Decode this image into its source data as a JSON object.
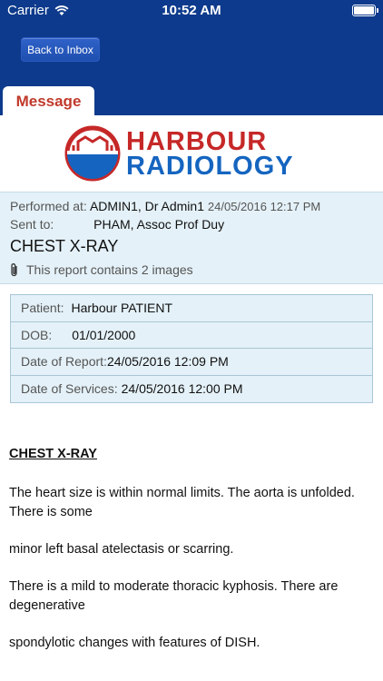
{
  "status_bar": {
    "carrier": "Carrier",
    "time": "10:52 AM"
  },
  "nav": {
    "back_label": "Back to Inbox",
    "tab_label": "Message"
  },
  "logo": {
    "word1": "HARBOUR",
    "word2": "RADIOLOGY"
  },
  "info": {
    "performed_label": "Performed at:",
    "performed_value": "ADMIN1, Dr Admin1",
    "performed_time": "24/05/2016 12:17 PM",
    "sent_label": "Sent to:",
    "sent_value": "PHAM, Assoc Prof Duy",
    "title": "CHEST X-RAY",
    "attachment_text": "This report contains 2 images"
  },
  "patient": {
    "rows": [
      {
        "label": "Patient:",
        "value": "Harbour PATIENT"
      },
      {
        "label": "DOB:",
        "value": "01/01/2000"
      },
      {
        "label": "Date of Report:",
        "value": "24/05/2016 12:09 PM"
      },
      {
        "label": "Date of Services:",
        "value": "24/05/2016 12:00 PM"
      }
    ]
  },
  "report": {
    "heading": "CHEST X-RAY",
    "paragraphs": [
      "The heart size is within normal limits. The aorta is unfolded. There is some",
      "minor left basal atelectasis or scarring.",
      "There is a mild to moderate thoracic kyphosis. There are degenerative",
      "spondylotic changes with features of DISH."
    ]
  },
  "colors": {
    "header_bg": "#0d3a8c",
    "tab_text": "#c0392b",
    "info_bg": "#e4f1f8",
    "logo_red": "#c62828",
    "logo_blue": "#1565c0"
  }
}
